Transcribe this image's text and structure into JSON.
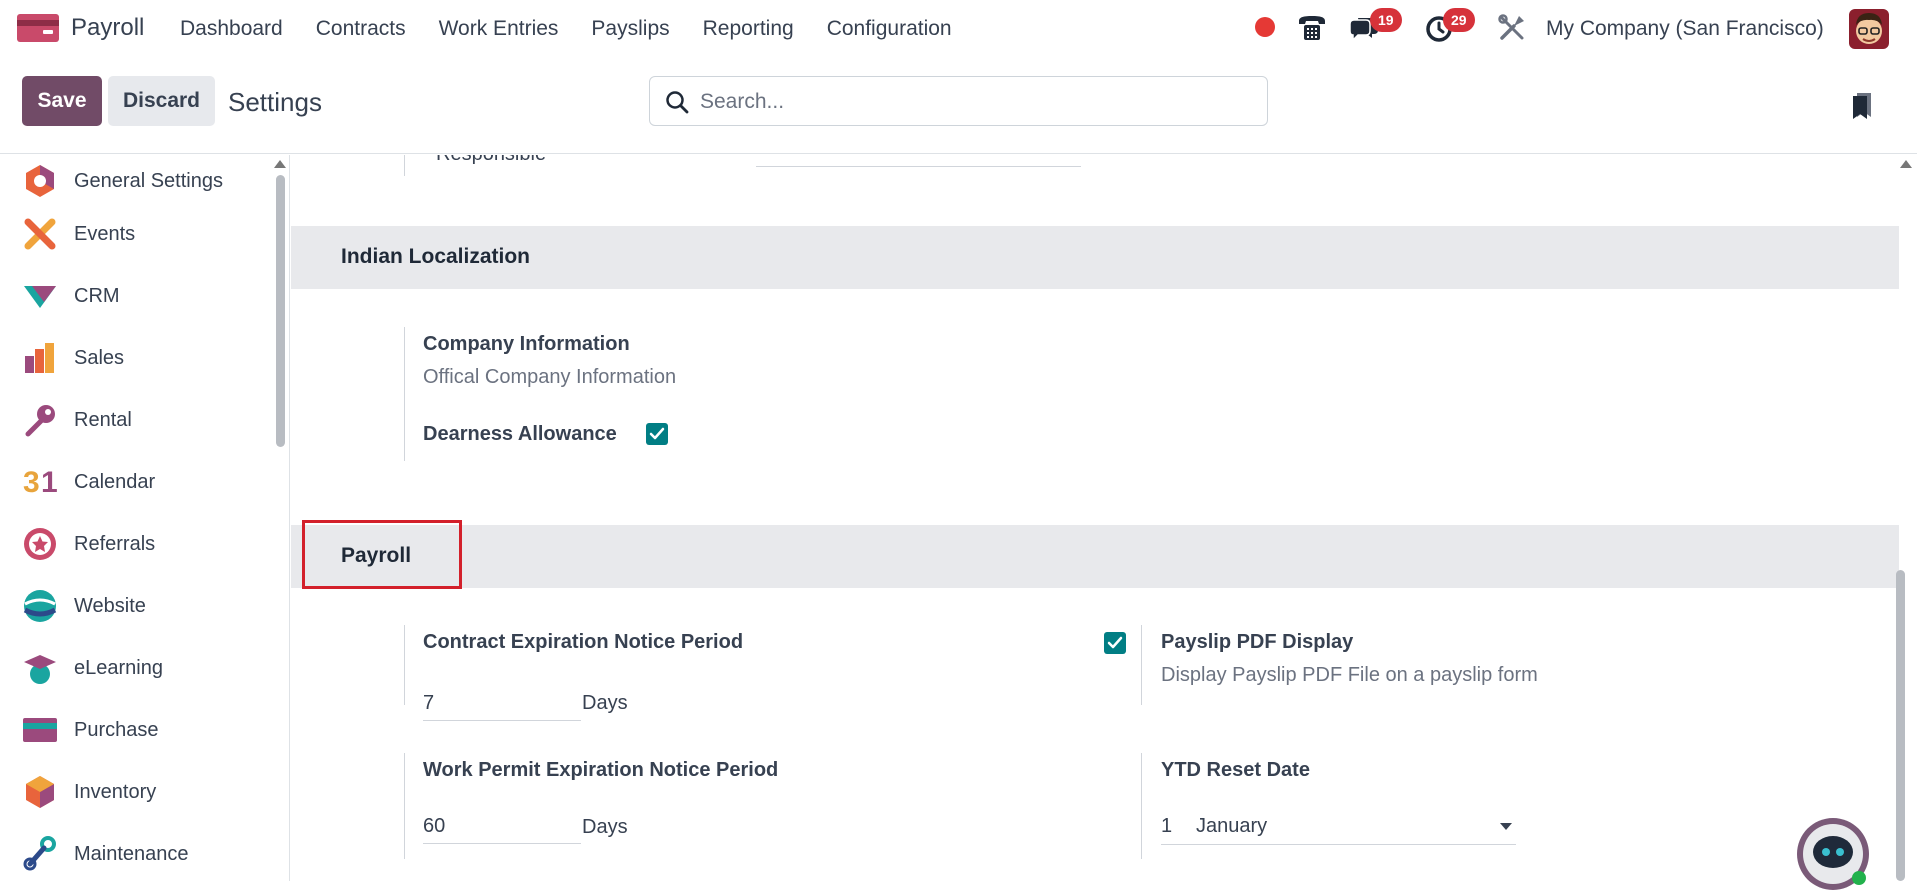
{
  "navbar": {
    "app_name": "Payroll",
    "menu": [
      "Dashboard",
      "Contracts",
      "Work Entries",
      "Payslips",
      "Reporting",
      "Configuration"
    ],
    "messages_count": "19",
    "activities_count": "29",
    "company": "My Company (San Francisco)"
  },
  "control": {
    "save_label": "Save",
    "discard_label": "Discard",
    "breadcrumb": "Settings",
    "search_placeholder": "Search..."
  },
  "sidebar": {
    "items": [
      {
        "label": "General Settings",
        "icon": "general-settings-icon"
      },
      {
        "label": "Events",
        "icon": "events-icon"
      },
      {
        "label": "CRM",
        "icon": "crm-icon"
      },
      {
        "label": "Sales",
        "icon": "sales-icon"
      },
      {
        "label": "Rental",
        "icon": "rental-icon"
      },
      {
        "label": "Calendar",
        "icon": "calendar-icon"
      },
      {
        "label": "Referrals",
        "icon": "referrals-icon"
      },
      {
        "label": "Website",
        "icon": "website-icon"
      },
      {
        "label": "eLearning",
        "icon": "elearning-icon"
      },
      {
        "label": "Purchase",
        "icon": "purchase-icon"
      },
      {
        "label": "Inventory",
        "icon": "inventory-icon"
      },
      {
        "label": "Maintenance",
        "icon": "maintenance-icon"
      }
    ]
  },
  "main": {
    "cut_off_label": "Responsible",
    "indian": {
      "title": "Indian Localization",
      "company_info_title": "Company Information",
      "company_info_desc": "Offical Company Information",
      "dearness_label": "Dearness Allowance",
      "dearness_checked": true
    },
    "payroll": {
      "title": "Payroll",
      "contract_notice_title": "Contract Expiration Notice Period",
      "contract_notice_value": "7",
      "contract_notice_unit": "Days",
      "work_permit_title": "Work Permit Expiration Notice Period",
      "work_permit_value": "60",
      "work_permit_unit": "Days",
      "payslip_pdf_title": "Payslip PDF Display",
      "payslip_pdf_desc": "Display Payslip PDF File on a payslip form",
      "payslip_pdf_checked": true,
      "ytd_title": "YTD Reset Date",
      "ytd_day": "1",
      "ytd_month": "January"
    }
  },
  "colors": {
    "brand": "#714b67",
    "checkbox": "#017e84",
    "badge": "#d6323a",
    "highlight": "#d3202b"
  }
}
